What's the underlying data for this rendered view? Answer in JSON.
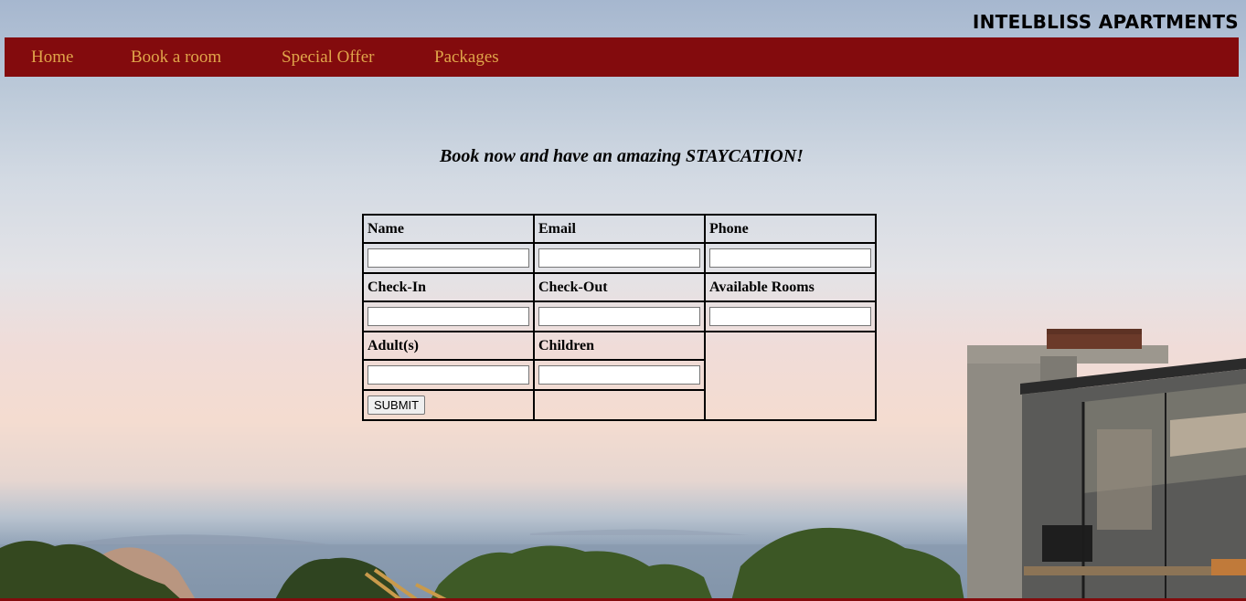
{
  "brand": {
    "title": "INTELBLISS APARTMENTS"
  },
  "nav": {
    "items": [
      {
        "label": "Home"
      },
      {
        "label": "Book a room"
      },
      {
        "label": "Special Offer"
      },
      {
        "label": "Packages"
      }
    ]
  },
  "main": {
    "headline": "Book now and have an amazing STAYCATION!"
  },
  "form": {
    "labels": {
      "name": "Name",
      "email": "Email",
      "phone": "Phone",
      "checkin": "Check-In",
      "checkout": "Check-Out",
      "rooms": "Available Rooms",
      "adults": "Adult(s)",
      "children": "Children"
    },
    "values": {
      "name": "",
      "email": "",
      "phone": "",
      "checkin": "",
      "checkout": "",
      "rooms": "",
      "adults": "",
      "children": ""
    },
    "submit_label": "SUBMIT"
  },
  "colors": {
    "nav_background": "#830b0d",
    "nav_link": "#e0a54a"
  }
}
